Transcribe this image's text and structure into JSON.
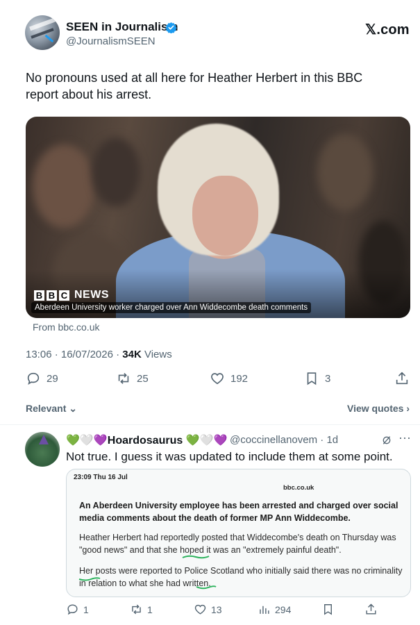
{
  "tweet": {
    "author_name": "SEEN in Journalism",
    "author_handle": "@JournalismSEEN",
    "platform_logo": "𝕏.com",
    "text": "No pronouns used at all here for Heather Herbert in this BBC report about his arrest.",
    "media": {
      "bbc_letters": [
        "B",
        "B",
        "C"
      ],
      "bbc_news": "NEWS",
      "caption": "Aberdeen University worker charged over Ann Widdecombe death comments",
      "source": "From bbc.co.uk"
    },
    "timestamp": "13:06 · 16/07/2026 · ",
    "views_count": "34K",
    "views_label": " Views",
    "stats": {
      "replies": "29",
      "reposts": "25",
      "likes": "192",
      "bookmarks": "3"
    },
    "verified_color": "#1d9bf0"
  },
  "sort": {
    "label": "Relevant ⌄",
    "view_quotes": "View quotes ›"
  },
  "reply": {
    "name": "💚🤍💜Hoardosaurus 💚🤍💜",
    "handle_time": "@coccinellanovem · 1d",
    "text": "Not true. I guess it was updated to include them at some point.",
    "screenshot": {
      "status_bar": "23:09  Thu 16 Jul",
      "url": "bbc.co.uk",
      "headline": "An Aberdeen University employee has been arrested and charged over social media comments about the death of former MP Ann Widdecombe.",
      "para1": "Heather Herbert had reportedly posted that Widdecombe's death on Thursday was \"good news\" and that she hoped it was an \"extremely painful death\".",
      "para2": "Her posts were reported to Police Scotland who initially said there was no criminality in relation to what she had written.",
      "underline_color": "#2db35d"
    },
    "stats": {
      "replies": "1",
      "reposts": "1",
      "likes": "13",
      "views": "294"
    }
  },
  "colors": {
    "text": "#0f1419",
    "muted": "#536471",
    "accent": "#1d9bf0"
  }
}
